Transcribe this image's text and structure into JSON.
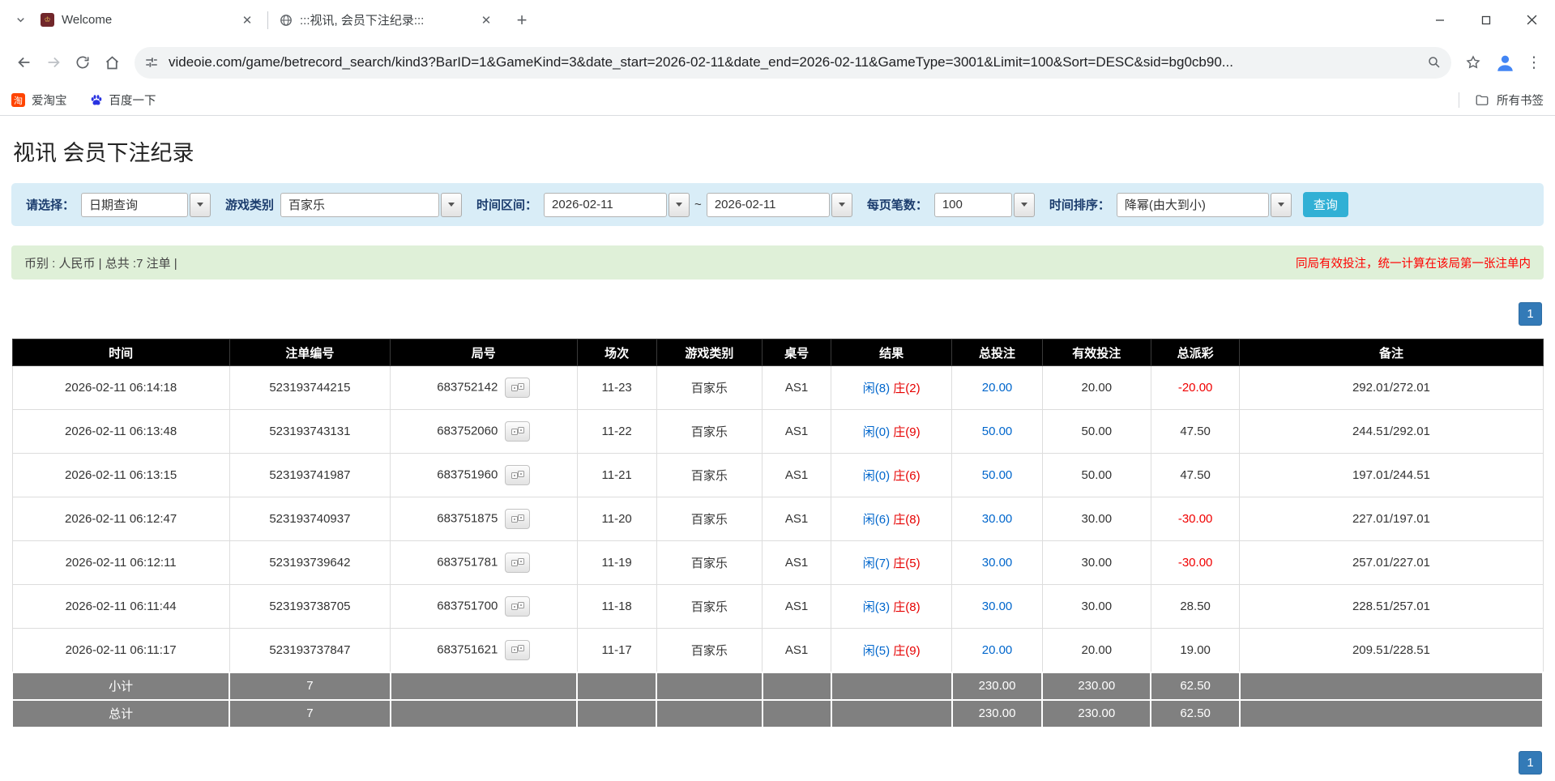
{
  "browser": {
    "tabs": [
      {
        "title": "Welcome"
      },
      {
        "title": ":::视讯, 会员下注纪录:::"
      }
    ],
    "url": "videoie.com/game/betrecord_search/kind3?BarID=1&GameKind=3&date_start=2026-02-11&date_end=2026-02-11&GameType=3001&Limit=100&Sort=DESC&sid=bg0cb90...",
    "bookmarks": [
      {
        "label": "爱淘宝"
      },
      {
        "label": "百度一下"
      }
    ],
    "all_bookmarks_label": "所有书签"
  },
  "page": {
    "title": "视讯 会员下注纪录",
    "filters": {
      "select_label": "请选择：",
      "select_value": "日期查询",
      "game_label": "游戏类别",
      "game_value": "百家乐",
      "range_label": "时间区间：",
      "date_start": "2026-02-11",
      "range_separator": "~",
      "date_end": "2026-02-11",
      "per_page_label": "每页笔数：",
      "per_page_value": "100",
      "sort_label": "时间排序：",
      "sort_value": "降幂(由大到小)",
      "search_button": "查询"
    },
    "info_bar": {
      "summary": "币别 : 人民币 | 总共 :7 注单 |",
      "notice": "同局有效投注，统一计算在该局第一张注单内"
    },
    "pagination": {
      "page": "1"
    },
    "table": {
      "headers": [
        "时间",
        "注单编号",
        "局号",
        "场次",
        "游戏类别",
        "桌号",
        "结果",
        "总投注",
        "有效投注",
        "总派彩",
        "备注"
      ],
      "rows": [
        {
          "time": "2026-02-11 06:14:18",
          "bet_id": "523193744215",
          "round": "683752142",
          "session": "11-23",
          "game": "百家乐",
          "table": "AS1",
          "result_player": "闲(8)",
          "result_banker": "庄(2)",
          "total_bet": "20.00",
          "valid_bet": "20.00",
          "payout": "-20.00",
          "note": "292.01/272.01"
        },
        {
          "time": "2026-02-11 06:13:48",
          "bet_id": "523193743131",
          "round": "683752060",
          "session": "11-22",
          "game": "百家乐",
          "table": "AS1",
          "result_player": "闲(0)",
          "result_banker": "庄(9)",
          "total_bet": "50.00",
          "valid_bet": "50.00",
          "payout": "47.50",
          "note": "244.51/292.01"
        },
        {
          "time": "2026-02-11 06:13:15",
          "bet_id": "523193741987",
          "round": "683751960",
          "session": "11-21",
          "game": "百家乐",
          "table": "AS1",
          "result_player": "闲(0)",
          "result_banker": "庄(6)",
          "total_bet": "50.00",
          "valid_bet": "50.00",
          "payout": "47.50",
          "note": "197.01/244.51"
        },
        {
          "time": "2026-02-11 06:12:47",
          "bet_id": "523193740937",
          "round": "683751875",
          "session": "11-20",
          "game": "百家乐",
          "table": "AS1",
          "result_player": "闲(6)",
          "result_banker": "庄(8)",
          "total_bet": "30.00",
          "valid_bet": "30.00",
          "payout": "-30.00",
          "note": "227.01/197.01"
        },
        {
          "time": "2026-02-11 06:12:11",
          "bet_id": "523193739642",
          "round": "683751781",
          "session": "11-19",
          "game": "百家乐",
          "table": "AS1",
          "result_player": "闲(7)",
          "result_banker": "庄(5)",
          "total_bet": "30.00",
          "valid_bet": "30.00",
          "payout": "-30.00",
          "note": "257.01/227.01"
        },
        {
          "time": "2026-02-11 06:11:44",
          "bet_id": "523193738705",
          "round": "683751700",
          "session": "11-18",
          "game": "百家乐",
          "table": "AS1",
          "result_player": "闲(3)",
          "result_banker": "庄(8)",
          "total_bet": "30.00",
          "valid_bet": "30.00",
          "payout": "28.50",
          "note": "228.51/257.01"
        },
        {
          "time": "2026-02-11 06:11:17",
          "bet_id": "523193737847",
          "round": "683751621",
          "session": "11-17",
          "game": "百家乐",
          "table": "AS1",
          "result_player": "闲(5)",
          "result_banker": "庄(9)",
          "total_bet": "20.00",
          "valid_bet": "20.00",
          "payout": "19.00",
          "note": "209.51/228.51"
        }
      ],
      "subtotal": {
        "label": "小计",
        "count": "7",
        "total_bet": "230.00",
        "valid_bet": "230.00",
        "payout": "62.50"
      },
      "total": {
        "label": "总计",
        "count": "7",
        "total_bet": "230.00",
        "valid_bet": "230.00",
        "payout": "62.50"
      }
    },
    "colors": {
      "accent_blue": "#0066cc",
      "negative_red": "#f00000",
      "filter_bg": "#d9edf7",
      "info_bg": "#dff0d8",
      "header_bg": "#000000",
      "footer_bg": "#808080",
      "search_button": "#31b0d5",
      "pager_blue": "#337ab7"
    }
  }
}
